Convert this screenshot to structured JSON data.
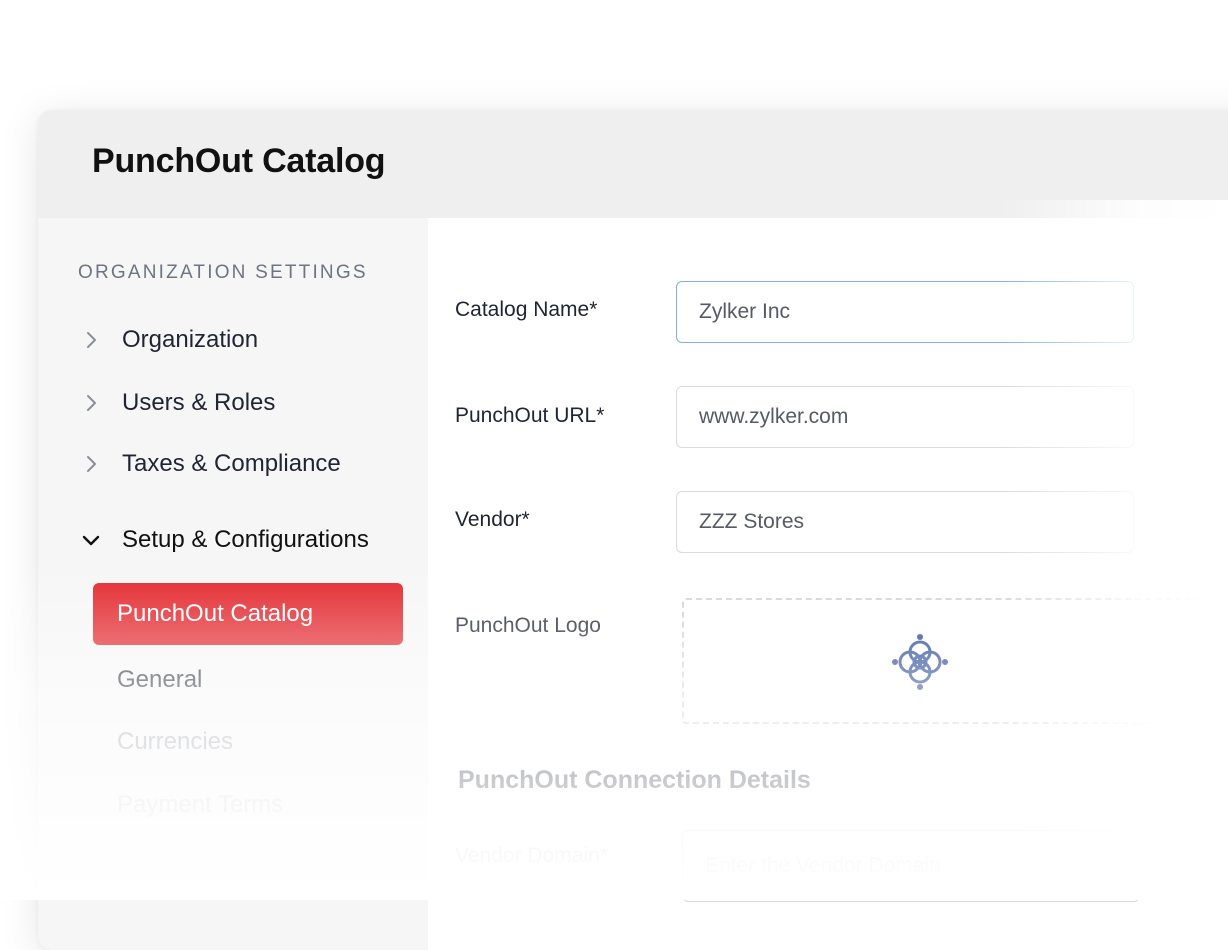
{
  "header": {
    "title": "PunchOut Catalog"
  },
  "sidebar": {
    "section_heading": "ORGANIZATION SETTINGS",
    "items": [
      {
        "label": "Organization",
        "icon": "chevron-right-icon"
      },
      {
        "label": "Users & Roles",
        "icon": "chevron-right-icon"
      },
      {
        "label": "Taxes & Compliance",
        "icon": "chevron-right-icon"
      },
      {
        "label": "Setup & Configurations",
        "icon": "chevron-down-icon",
        "expanded": true
      }
    ],
    "sub_items": [
      {
        "label": "PunchOut Catalog",
        "active": true
      },
      {
        "label": "General"
      },
      {
        "label": "Currencies"
      },
      {
        "label": "Payment Terms"
      }
    ]
  },
  "form": {
    "catalog_name": {
      "label": "Catalog Name*",
      "value": "Zylker Inc"
    },
    "punchout_url": {
      "label": "PunchOut URL*",
      "value": "www.zylker.com"
    },
    "vendor": {
      "label": "Vendor*",
      "value": "ZZZ Stores"
    },
    "logo": {
      "label": "PunchOut Logo",
      "icon": "mandala-logo-icon"
    }
  },
  "connection": {
    "title": "PunchOut Connection Details",
    "vendor_domain": {
      "label": "Vendor Domain*",
      "placeholder": "Enter the Vendor Domain"
    }
  },
  "colors": {
    "accent": "#e22329",
    "focus_border": "#7fb0e3",
    "logo": "#1c3d8f"
  }
}
